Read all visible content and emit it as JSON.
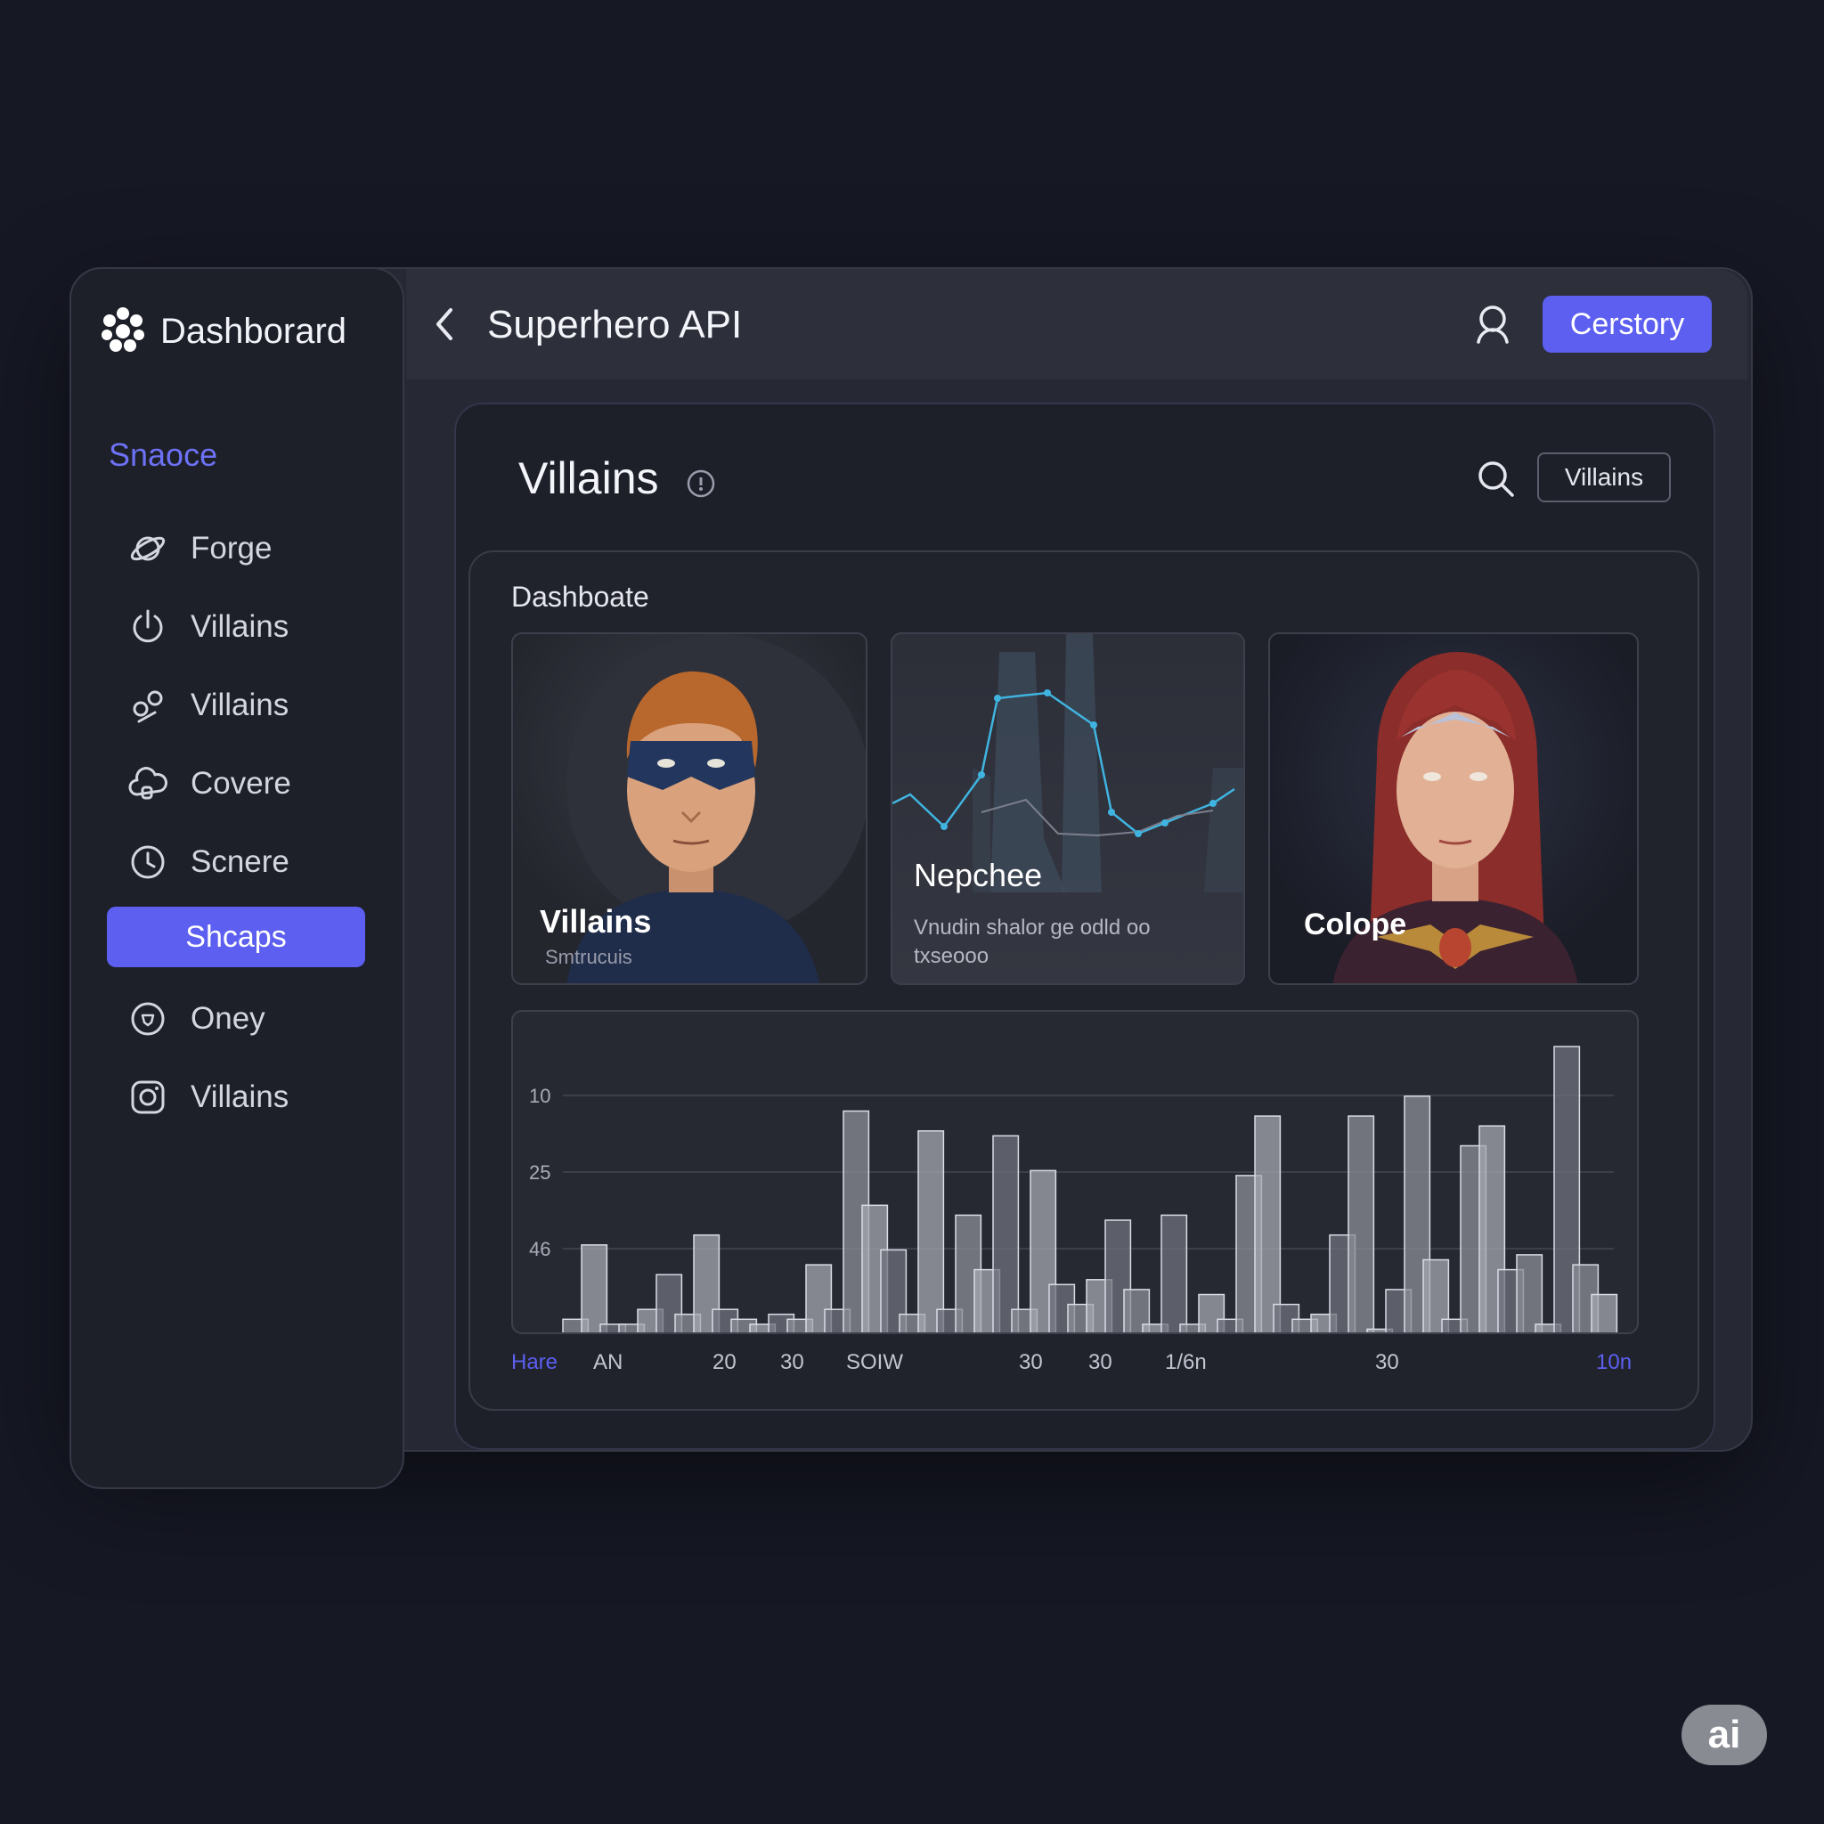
{
  "sidebar": {
    "title": "Dashborard",
    "section_label": "Snaoce",
    "items": [
      {
        "label": "Forge",
        "icon": "planet-icon"
      },
      {
        "label": "Villains",
        "icon": "power-icon"
      },
      {
        "label": "Villains",
        "icon": "link-icon"
      },
      {
        "label": "Covere",
        "icon": "cloud-icon"
      },
      {
        "label": "Scnere",
        "icon": "clock-icon"
      },
      {
        "label": "Shcaps",
        "icon": "none",
        "active": true
      },
      {
        "label": "Oney",
        "icon": "shield-icon"
      },
      {
        "label": "Villains",
        "icon": "camera-icon"
      }
    ]
  },
  "header": {
    "title": "Superhero API",
    "button_label": "Cerstory"
  },
  "panel": {
    "title": "Villains",
    "filter_label": "Villains",
    "inner_title": "Dashboate",
    "cards": [
      {
        "name": "Villains",
        "subtitle": "Smtrucuis"
      },
      {
        "name": "Nepchee",
        "subtitle": "Vnudin shalor ge odld oo txseooo"
      },
      {
        "name": "Colope"
      }
    ]
  },
  "chart_data": {
    "type": "bar",
    "y_tick_labels": [
      "10",
      "25",
      "46"
    ],
    "x_tick_labels": [
      "Hare",
      "AN",
      "20",
      "30",
      "SOIW",
      "30",
      "30",
      "1/6n",
      "30",
      "10n"
    ],
    "values": [
      3,
      18,
      2,
      2,
      5,
      12,
      4,
      20,
      5,
      3,
      2,
      4,
      3,
      14,
      5,
      45,
      26,
      17,
      4,
      41,
      5,
      24,
      13,
      40,
      5,
      33,
      10,
      6,
      11,
      23,
      9,
      2,
      24,
      2,
      8,
      3,
      32,
      44,
      6,
      3,
      4,
      20,
      44,
      1,
      9,
      48,
      15,
      3,
      38,
      42,
      13,
      16,
      2,
      58,
      14,
      8
    ],
    "accent": "#5c5ff0"
  },
  "badge": "ai"
}
